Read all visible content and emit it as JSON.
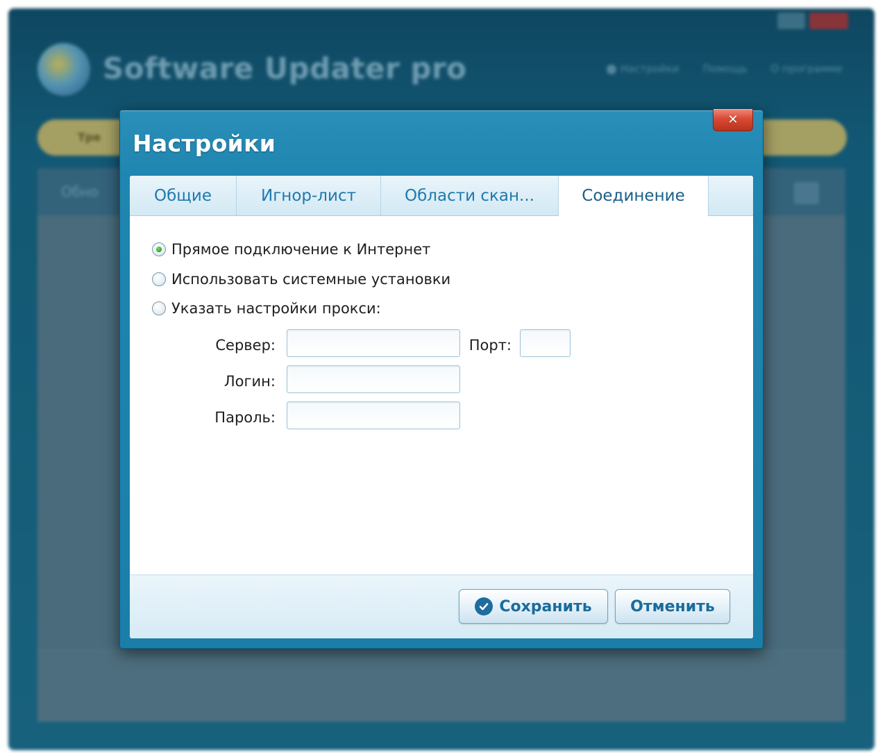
{
  "background": {
    "app_title": "Software Updater pro",
    "nav_items": [
      "Настройки",
      "Помощь",
      "О программе"
    ],
    "left_pill_label": "Tpe",
    "panel_header": "Обно"
  },
  "dialog": {
    "title": "Настройки",
    "close_glyph": "✕"
  },
  "tabs": [
    {
      "label": "Общие",
      "active": false
    },
    {
      "label": "Игнор-лист",
      "active": false
    },
    {
      "label": "Области скан...",
      "active": false
    },
    {
      "label": "Соединение",
      "active": true
    }
  ],
  "connection": {
    "options": [
      {
        "label": "Прямое подключение к Интернет",
        "selected": true
      },
      {
        "label": "Использовать системные установки",
        "selected": false
      },
      {
        "label": "Указать настройки прокси:",
        "selected": false
      }
    ],
    "proxy": {
      "server_label": "Сервер:",
      "server_value": "",
      "port_label": "Порт:",
      "port_value": "",
      "login_label": "Логин:",
      "login_value": "",
      "password_label": "Пароль:",
      "password_value": ""
    }
  },
  "footer": {
    "save_label": "Сохранить",
    "cancel_label": "Отменить"
  },
  "colors": {
    "dialog_blue": "#1f86b1",
    "tab_text": "#1f79ad",
    "button_text": "#1a6c9c",
    "radio_selected": "#2aa01c",
    "close_red": "#d94a33"
  },
  "icons": {
    "save": "check-circle-icon",
    "close": "close-icon",
    "settings": "gear-icon"
  }
}
